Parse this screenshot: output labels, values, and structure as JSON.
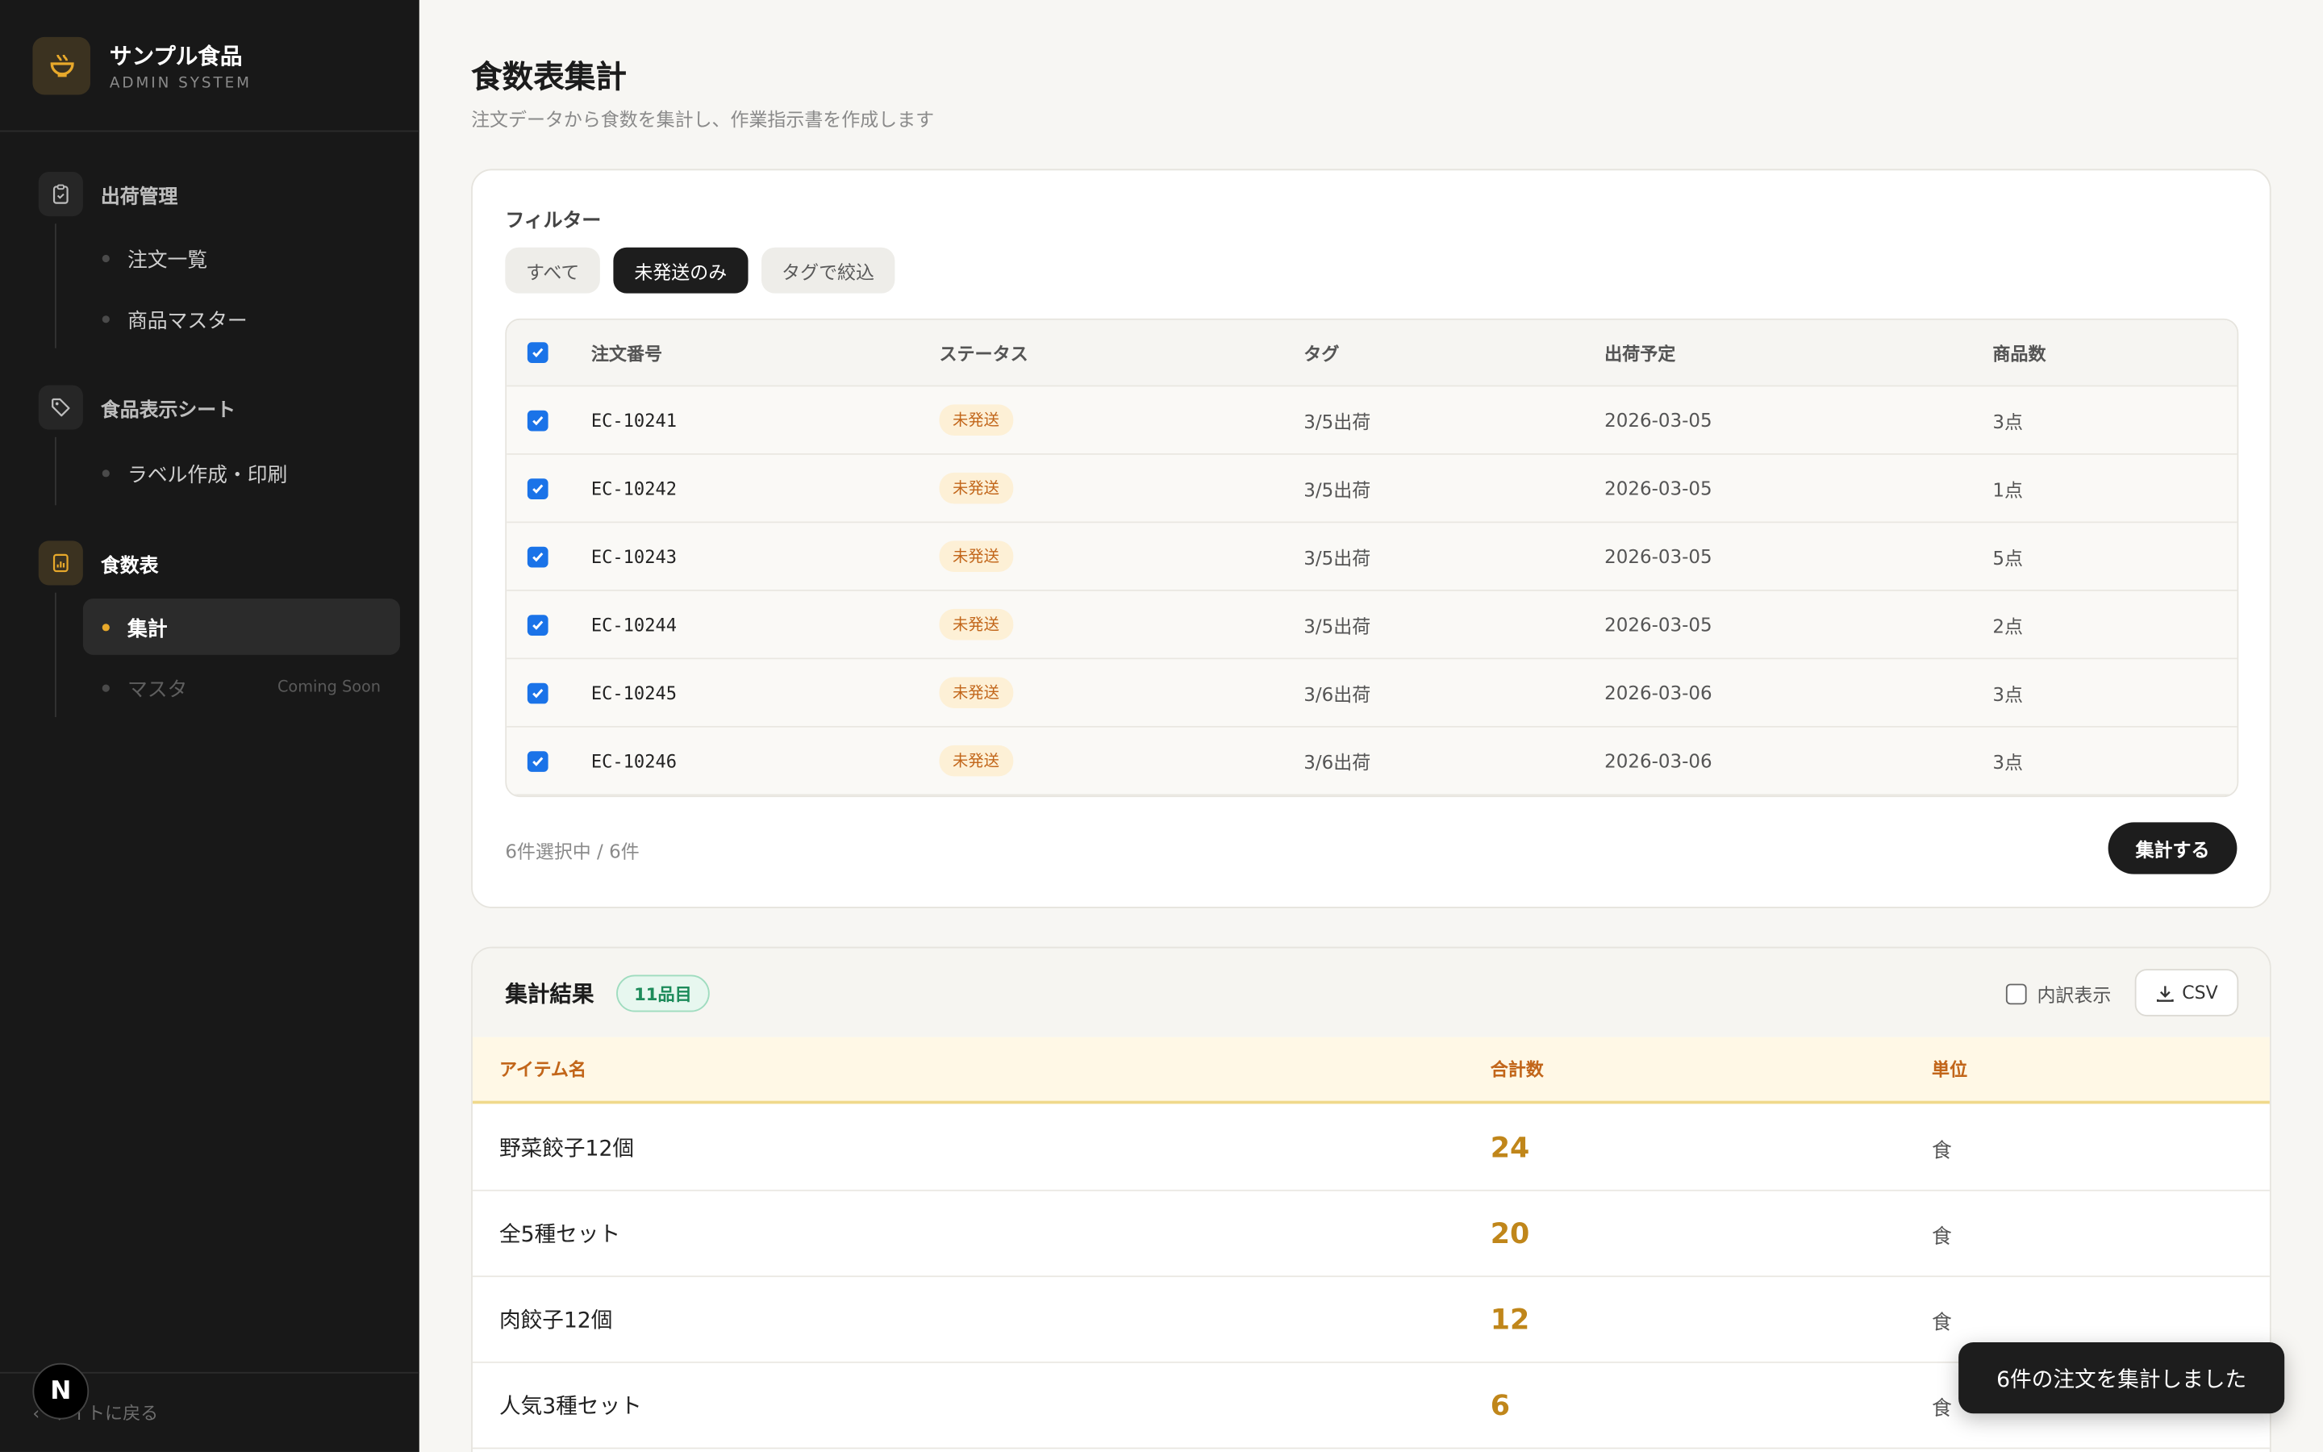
{
  "brand": {
    "name": "サンプル食品",
    "sub": "ADMIN SYSTEM"
  },
  "sidebar": {
    "groups": [
      {
        "label": "出荷管理",
        "icon": "clipboard-icon",
        "items": [
          {
            "label": "注文一覧"
          },
          {
            "label": "商品マスター"
          }
        ]
      },
      {
        "label": "食品表示シート",
        "icon": "tag-icon",
        "items": [
          {
            "label": "ラベル作成・印刷"
          }
        ]
      },
      {
        "label": "食数表",
        "icon": "report-icon",
        "items": [
          {
            "label": "集計",
            "active": true
          },
          {
            "label": "マスタ",
            "disabled": true,
            "note": "Coming Soon"
          }
        ]
      }
    ],
    "footer": "サイトに戻る"
  },
  "page": {
    "title": "食数表集計",
    "subtitle": "注文データから食数を集計し、作業指示書を作成します"
  },
  "filter": {
    "label": "フィルター",
    "chips": [
      {
        "label": "すべて"
      },
      {
        "label": "未発送のみ",
        "active": true
      },
      {
        "label": "タグで絞込"
      }
    ]
  },
  "orders": {
    "columns": [
      "注文番号",
      "ステータス",
      "タグ",
      "出荷予定",
      "商品数"
    ],
    "rows": [
      {
        "id": "EC-10241",
        "status": "未発送",
        "tag": "3/5出荷",
        "date": "2026-03-05",
        "count": "3点"
      },
      {
        "id": "EC-10242",
        "status": "未発送",
        "tag": "3/5出荷",
        "date": "2026-03-05",
        "count": "1点"
      },
      {
        "id": "EC-10243",
        "status": "未発送",
        "tag": "3/5出荷",
        "date": "2026-03-05",
        "count": "5点"
      },
      {
        "id": "EC-10244",
        "status": "未発送",
        "tag": "3/5出荷",
        "date": "2026-03-05",
        "count": "2点"
      },
      {
        "id": "EC-10245",
        "status": "未発送",
        "tag": "3/6出荷",
        "date": "2026-03-06",
        "count": "3点"
      },
      {
        "id": "EC-10246",
        "status": "未発送",
        "tag": "3/6出荷",
        "date": "2026-03-06",
        "count": "3点"
      }
    ],
    "selection": "6件選択中 / 6件",
    "aggregate_button": "集計する"
  },
  "results": {
    "title": "集計結果",
    "count_badge": "11品目",
    "breakdown_label": "内訳表示",
    "csv_label": "CSV",
    "columns": [
      "アイテム名",
      "合計数",
      "単位"
    ],
    "rows": [
      {
        "name": "野菜餃子12個",
        "total": "24",
        "unit": "食"
      },
      {
        "name": "全5種セット",
        "total": "20",
        "unit": "食"
      },
      {
        "name": "肉餃子12個",
        "total": "12",
        "unit": "食"
      },
      {
        "name": "人気3種セット",
        "total": "6",
        "unit": "食"
      }
    ]
  },
  "toast": "6件の注文を集計しました",
  "dev_badge": "N",
  "colors": {
    "accent": "#e8a92b",
    "sidebar": "#181818",
    "checkbox": "#1a73e8",
    "status": "#c2661a",
    "success": "#1d8b5a"
  }
}
